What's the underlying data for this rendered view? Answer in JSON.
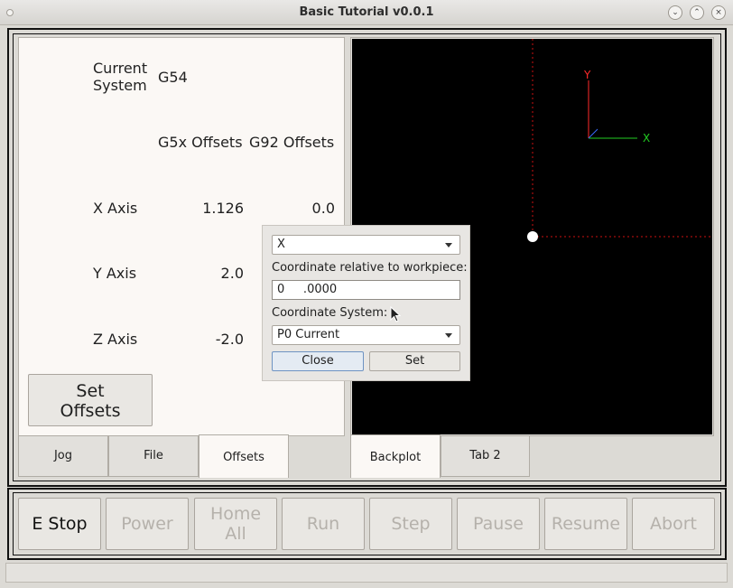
{
  "window": {
    "title": "Basic Tutorial v0.0.1"
  },
  "offsets_panel": {
    "current_label": "Current System",
    "current_value": "G54",
    "col_g5x": "G5x Offsets",
    "col_g92": "G92 Offsets",
    "axes": [
      {
        "label": "X Axis",
        "g5x": "1.126",
        "g92": "0.0"
      },
      {
        "label": "Y Axis",
        "g5x": "2.0"
      },
      {
        "label": "Z Axis",
        "g5x": "-2.0"
      }
    ],
    "set_offsets_label": "Set Offsets"
  },
  "left_tabs": [
    "Jog",
    "File",
    "Offsets"
  ],
  "left_active_tab": "Offsets",
  "right_tabs": [
    "Backplot",
    "Tab 2"
  ],
  "right_active_tab": "Backplot",
  "backplot": {
    "axis_y_label": "Y",
    "axis_x_label": "X",
    "axis_y_color": "#ff2a2a",
    "axis_x_color": "#22cc22",
    "limit_color": "#cc1111"
  },
  "dialog": {
    "axis_select": "X",
    "coord_label": "Coordinate relative to workpiece:",
    "coord_value": "0     .0000",
    "system_label": "Coordinate System:",
    "system_select": "P0 Current",
    "close_label": "Close",
    "set_label": "Set"
  },
  "controls": [
    {
      "label": "E Stop",
      "enabled": true
    },
    {
      "label": "Power",
      "enabled": false
    },
    {
      "label": "Home All",
      "enabled": false
    },
    {
      "label": "Run",
      "enabled": false
    },
    {
      "label": "Step",
      "enabled": false
    },
    {
      "label": "Pause",
      "enabled": false
    },
    {
      "label": "Resume",
      "enabled": false
    },
    {
      "label": "Abort",
      "enabled": false
    }
  ]
}
